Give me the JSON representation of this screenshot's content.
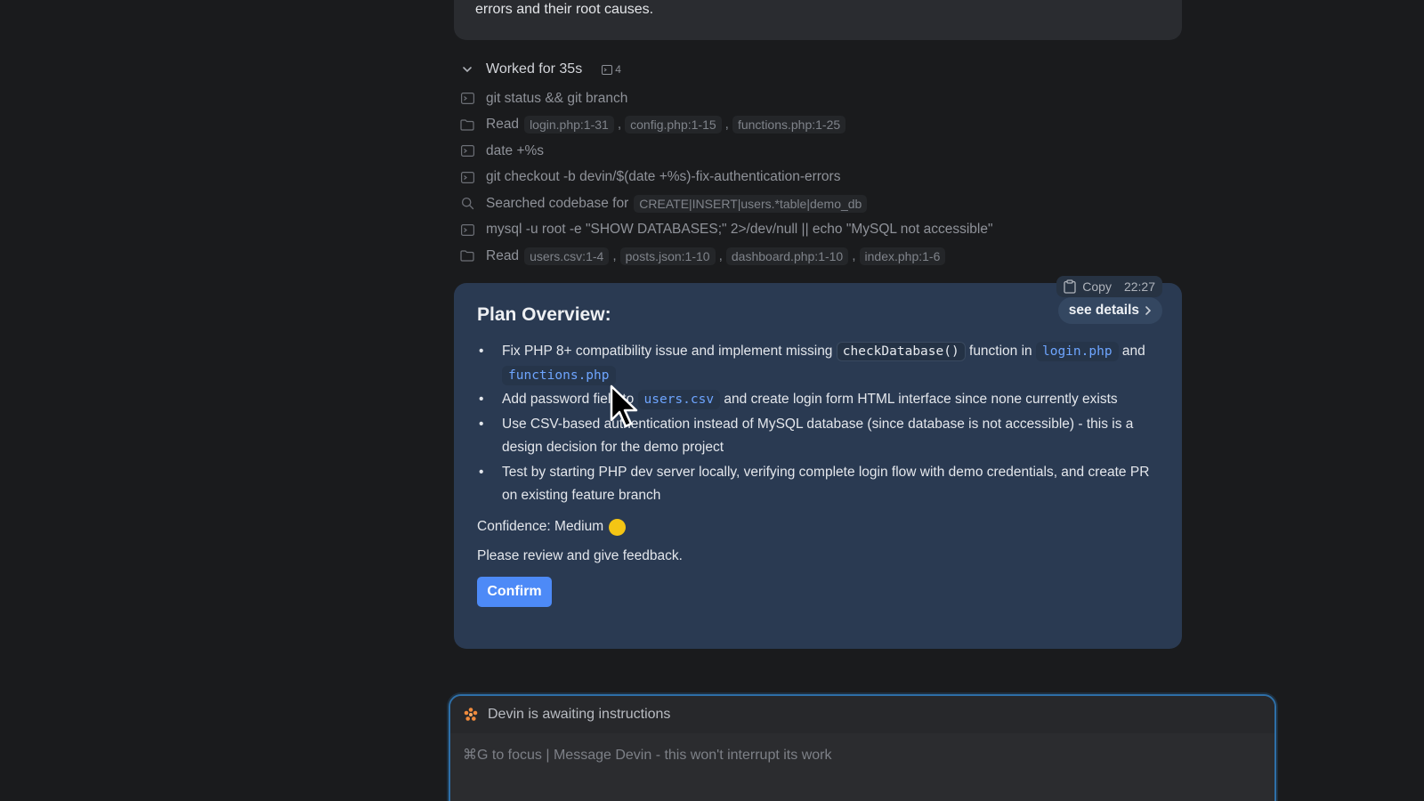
{
  "previous_message": {
    "text": "errors and their root causes."
  },
  "worklog": {
    "title": "Worked for 35s",
    "count": "4",
    "rows": [
      {
        "icon": "terminal-icon",
        "text": "git status && git branch",
        "chips": []
      },
      {
        "icon": "folder-icon",
        "text": "Read",
        "chips": [
          "login.php:1-31",
          "config.php:1-15",
          "functions.php:1-25"
        ]
      },
      {
        "icon": "terminal-icon",
        "text": "date +%s",
        "chips": []
      },
      {
        "icon": "terminal-icon",
        "text": "git checkout -b devin/$(date +%s)-fix-authentication-errors",
        "chips": []
      },
      {
        "icon": "search-icon",
        "text": "Searched codebase for",
        "chips": [
          "CREATE|INSERT|users.*table|demo_db"
        ]
      },
      {
        "icon": "terminal-icon",
        "text": "mysql -u root -e \"SHOW DATABASES;\" 2>/dev/null || echo \"MySQL not accessible\"",
        "chips": []
      },
      {
        "icon": "folder-icon",
        "text": "Read",
        "chips": [
          "users.csv:1-4",
          "posts.json:1-10",
          "dashboard.php:1-10",
          "index.php:1-6"
        ]
      }
    ]
  },
  "plan_card": {
    "copy_label": "Copy",
    "timestamp": "22:27",
    "see_details_label": "see details",
    "title": "Plan Overview:",
    "bullets": {
      "b1_part1": "Fix PHP 8+ compatibility issue and implement missing ",
      "b1_code1": "checkDatabase()",
      "b1_part2": " function in ",
      "b1_code2": "login.php",
      "b1_part3": " and ",
      "b1_code3": "functions.php",
      "b2_part1": "Add password field to ",
      "b2_code1": "users.csv",
      "b2_part2": " and create login form HTML interface since none currently exists",
      "b3": "Use CSV-based authentication instead of MySQL database (since database is not accessible) - this is a design decision for the demo project",
      "b4": "Test by starting PHP dev server locally, verifying complete login flow with demo credentials, and create PR on existing feature branch"
    },
    "confidence_label": "Confidence: Medium",
    "confidence_color": "#f4c514",
    "feedback_text": "Please review and give feedback.",
    "confirm_label": "Confirm"
  },
  "input_panel": {
    "status_text": "Devin is awaiting instructions",
    "placeholder": "⌘G to focus | Message Devin - this won't interrupt its work"
  },
  "colors": {
    "background": "#1a1b1d",
    "card": "#2a3a52",
    "accent": "#4d8af7",
    "code_link": "#6ea5ff"
  }
}
